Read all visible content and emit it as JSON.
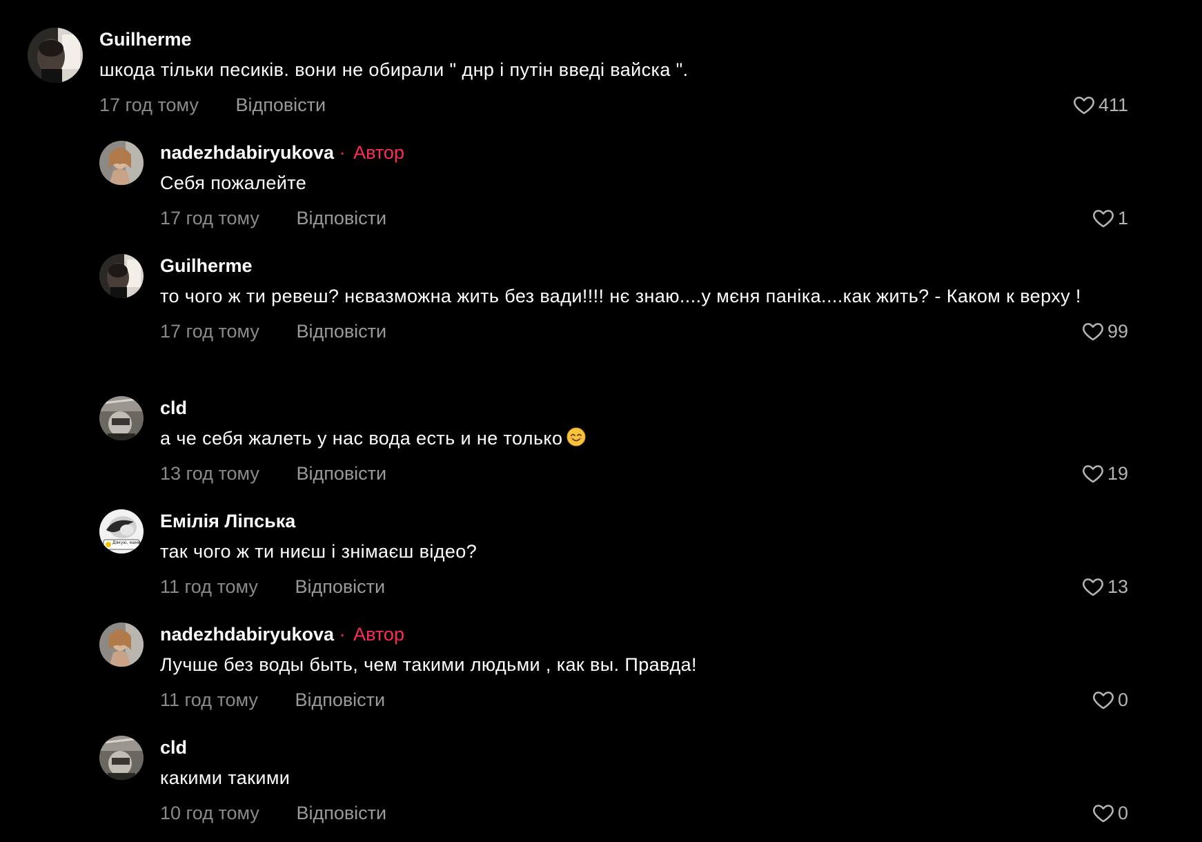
{
  "reply_label": "Відповісти",
  "author_label": "Автор",
  "author_separator": "·",
  "colors": {
    "background": "#000000",
    "author_tag": "#fe2c55",
    "meta_text": "#8a8a8a",
    "likes_text": "#b5b5b5"
  },
  "comments": [
    {
      "username": "Guilherme",
      "is_author": false,
      "text": "шкода тільки песиків. вони не обирали \" днр і путін введі вайска \".",
      "time": "17 год тому",
      "likes": "411",
      "avatar_icon": "avatar-guilherme"
    },
    {
      "username": "nadezhdabiryukova",
      "is_author": true,
      "text": "Себя пожалейте",
      "time": "17 год тому",
      "likes": "1",
      "avatar_icon": "avatar-nadezhda"
    },
    {
      "username": "Guilherme",
      "is_author": false,
      "text": "то чого ж ти ревеш? нєвазможна жить без вади!!!! нє знаю....у мєня паніка....как жить? - Каком к верху !",
      "time": "17 год тому",
      "likes": "99",
      "avatar_icon": "avatar-guilherme"
    },
    {
      "username": "cld",
      "is_author": false,
      "text": "а че себя жалеть у нас вода есть и не только",
      "emoji": "smiling-face-emoji",
      "time": "13 год тому",
      "likes": "19",
      "avatar_icon": "avatar-cld"
    },
    {
      "username": "Емілія Ліпська",
      "is_author": false,
      "text": "так чого ж ти ниєш і знімаєш відео?",
      "time": "11 год тому",
      "likes": "13",
      "avatar_icon": "avatar-emilia",
      "avatar_caption": "Дякую, мамо!"
    },
    {
      "username": "nadezhdabiryukova",
      "is_author": true,
      "text": "Лучше без воды быть, чем такими людьми , как вы. Правда!",
      "time": "11 год тому",
      "likes": "0",
      "avatar_icon": "avatar-nadezhda"
    },
    {
      "username": "cld",
      "is_author": false,
      "text": "какими такими",
      "time": "10 год тому",
      "likes": "0",
      "avatar_icon": "avatar-cld"
    }
  ]
}
